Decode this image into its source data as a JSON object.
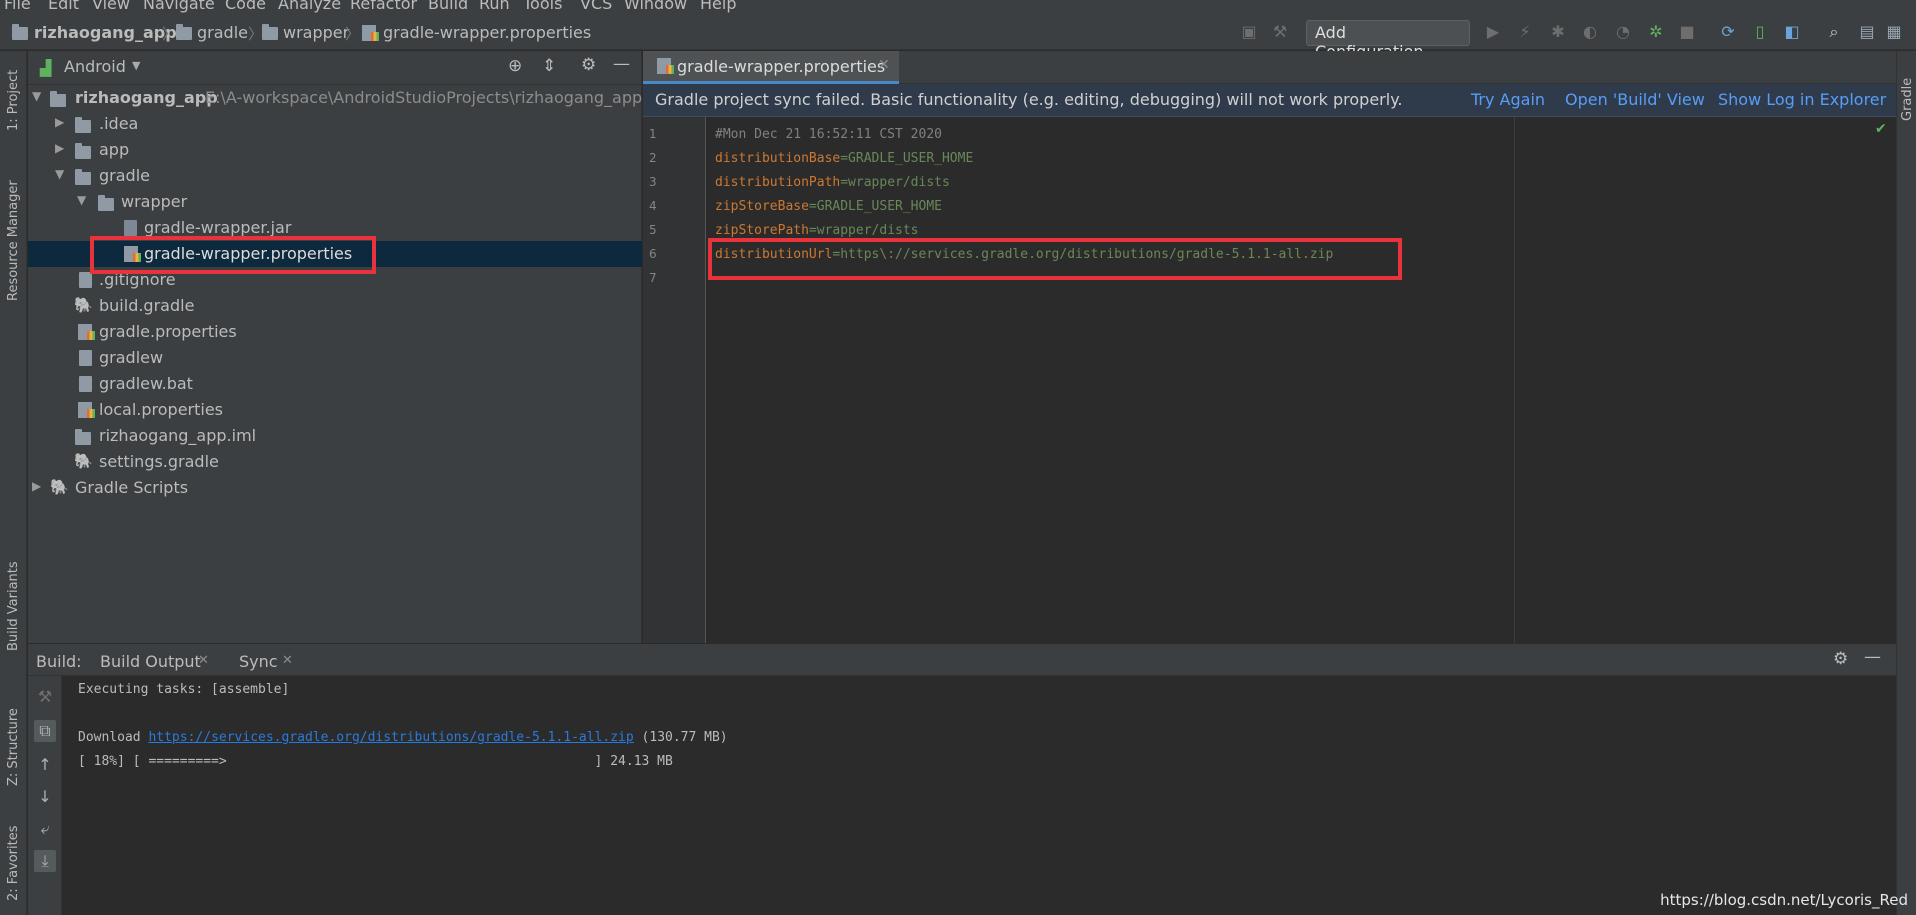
{
  "menu": [
    "File",
    "Edit",
    "View",
    "Navigate",
    "Code",
    "Analyze",
    "Refactor",
    "Build",
    "Run",
    "Tools",
    "VCS",
    "Window",
    "Help"
  ],
  "breadcrumb": [
    "rizhaogang_app",
    "gradle",
    "wrapper",
    "gradle-wrapper.properties"
  ],
  "toolbar": {
    "config_label": "Add Configuration..."
  },
  "left_tabs": {
    "project": "1: Project",
    "resource_manager": "Resource Manager",
    "build_variants": "Build Variants",
    "structure": "Z: Structure",
    "favorites": "2: Favorites"
  },
  "right_tabs": {
    "gradle": "Gradle"
  },
  "project": {
    "view": "Android",
    "root_name": "rizhaogang_app",
    "root_path": "E:\\A-workspace\\AndroidStudioProjects\\rizhaogang_app",
    "items": [
      ".idea",
      "app",
      "gradle",
      "wrapper",
      "gradle-wrapper.jar",
      "gradle-wrapper.properties",
      ".gitignore",
      "build.gradle",
      "gradle.properties",
      "gradlew",
      "gradlew.bat",
      "local.properties",
      "rizhaogang_app.iml",
      "settings.gradle",
      "Gradle Scripts"
    ]
  },
  "editor": {
    "tab": "gradle-wrapper.properties",
    "banner": {
      "message": "Gradle project sync failed. Basic functionality (e.g. editing, debugging) will not work properly.",
      "actions": [
        "Try Again",
        "Open 'Build' View",
        "Show Log in Explorer"
      ]
    },
    "line_numbers": [
      "1",
      "2",
      "3",
      "4",
      "5",
      "6",
      "7"
    ],
    "lines": [
      {
        "key": "#Mon Dec 21 16:52:11 CST 2020",
        "val": ""
      },
      {
        "key": "distributionBase",
        "val": "=GRADLE_USER_HOME"
      },
      {
        "key": "distributionPath",
        "val": "=wrapper/dists"
      },
      {
        "key": "zipStoreBase",
        "val": "=GRADLE_USER_HOME"
      },
      {
        "key": "zipStorePath",
        "val": "=wrapper/dists"
      },
      {
        "key": "distributionUrl",
        "val": "=https\\://services.gradle.org/distributions/gradle-5.1.1-all.zip"
      }
    ]
  },
  "build": {
    "label": "Build:",
    "tabs": [
      "Build Output",
      "Sync"
    ],
    "output": {
      "executing": "Executing tasks: [assemble]",
      "download_prefix": "Download ",
      "download_url": "https://services.gradle.org/distributions/gradle-5.1.1-all.zip",
      "download_size": " (130.77 MB)",
      "progress_line": "[ 18%] [ =========>                                               ] 24.13 MB"
    }
  },
  "watermark": "https://blog.csdn.net/Lycoris_Red",
  "colors": {
    "highlight_box": "#e8323c",
    "selection": "#0d293e",
    "link": "#287bde",
    "banner": "#2f3b4a"
  }
}
